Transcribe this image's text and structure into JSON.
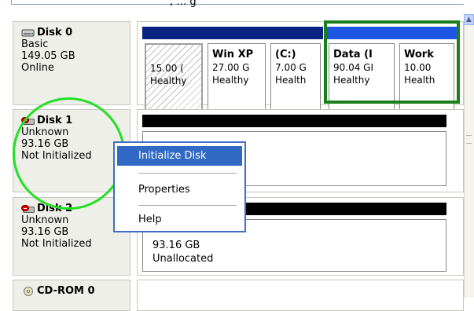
{
  "top": {
    "partial_text": ", …        g"
  },
  "disks": [
    {
      "name": "Disk 0",
      "type": "Basic",
      "size": "149.05 GB",
      "status": "Online",
      "icon": "hard-disk-icon"
    },
    {
      "name": "Disk 1",
      "type": "Unknown",
      "size": "93.16 GB",
      "status": "Not Initialized",
      "icon": "disk-error-icon"
    },
    {
      "name": "Disk 2",
      "type": "Unknown",
      "size": "93.16 GB",
      "status": "Not Initialized",
      "icon": "disk-error-icon"
    },
    {
      "name": "CD-ROM 0",
      "icon": "cdrom-icon"
    }
  ],
  "partitions": [
    {
      "name": "",
      "size": "15.00 (",
      "status": "Healthy"
    },
    {
      "name": "Win XP",
      "size": "27.00 G",
      "status": "Healthy"
    },
    {
      "name": "(C:)",
      "size": "7.00 G",
      "status": "Health"
    },
    {
      "name": "Data (I",
      "size": "90.04 GI",
      "status": "Healthy"
    },
    {
      "name": "Work",
      "size": "10.00",
      "status": "Health"
    }
  ],
  "disk2_area": {
    "size": "93.16 GB",
    "status": "Unallocated"
  },
  "context_menu": {
    "items": [
      "Initialize Disk",
      "Properties",
      "Help"
    ],
    "highlighted_index": 0
  },
  "colors": {
    "primary_bar": "#0a2380",
    "logical_bar": "#1e56e4",
    "highlight_box": "#1a7f1a",
    "annotation_circle": "#22e022",
    "menu_selection": "#316ac5"
  }
}
